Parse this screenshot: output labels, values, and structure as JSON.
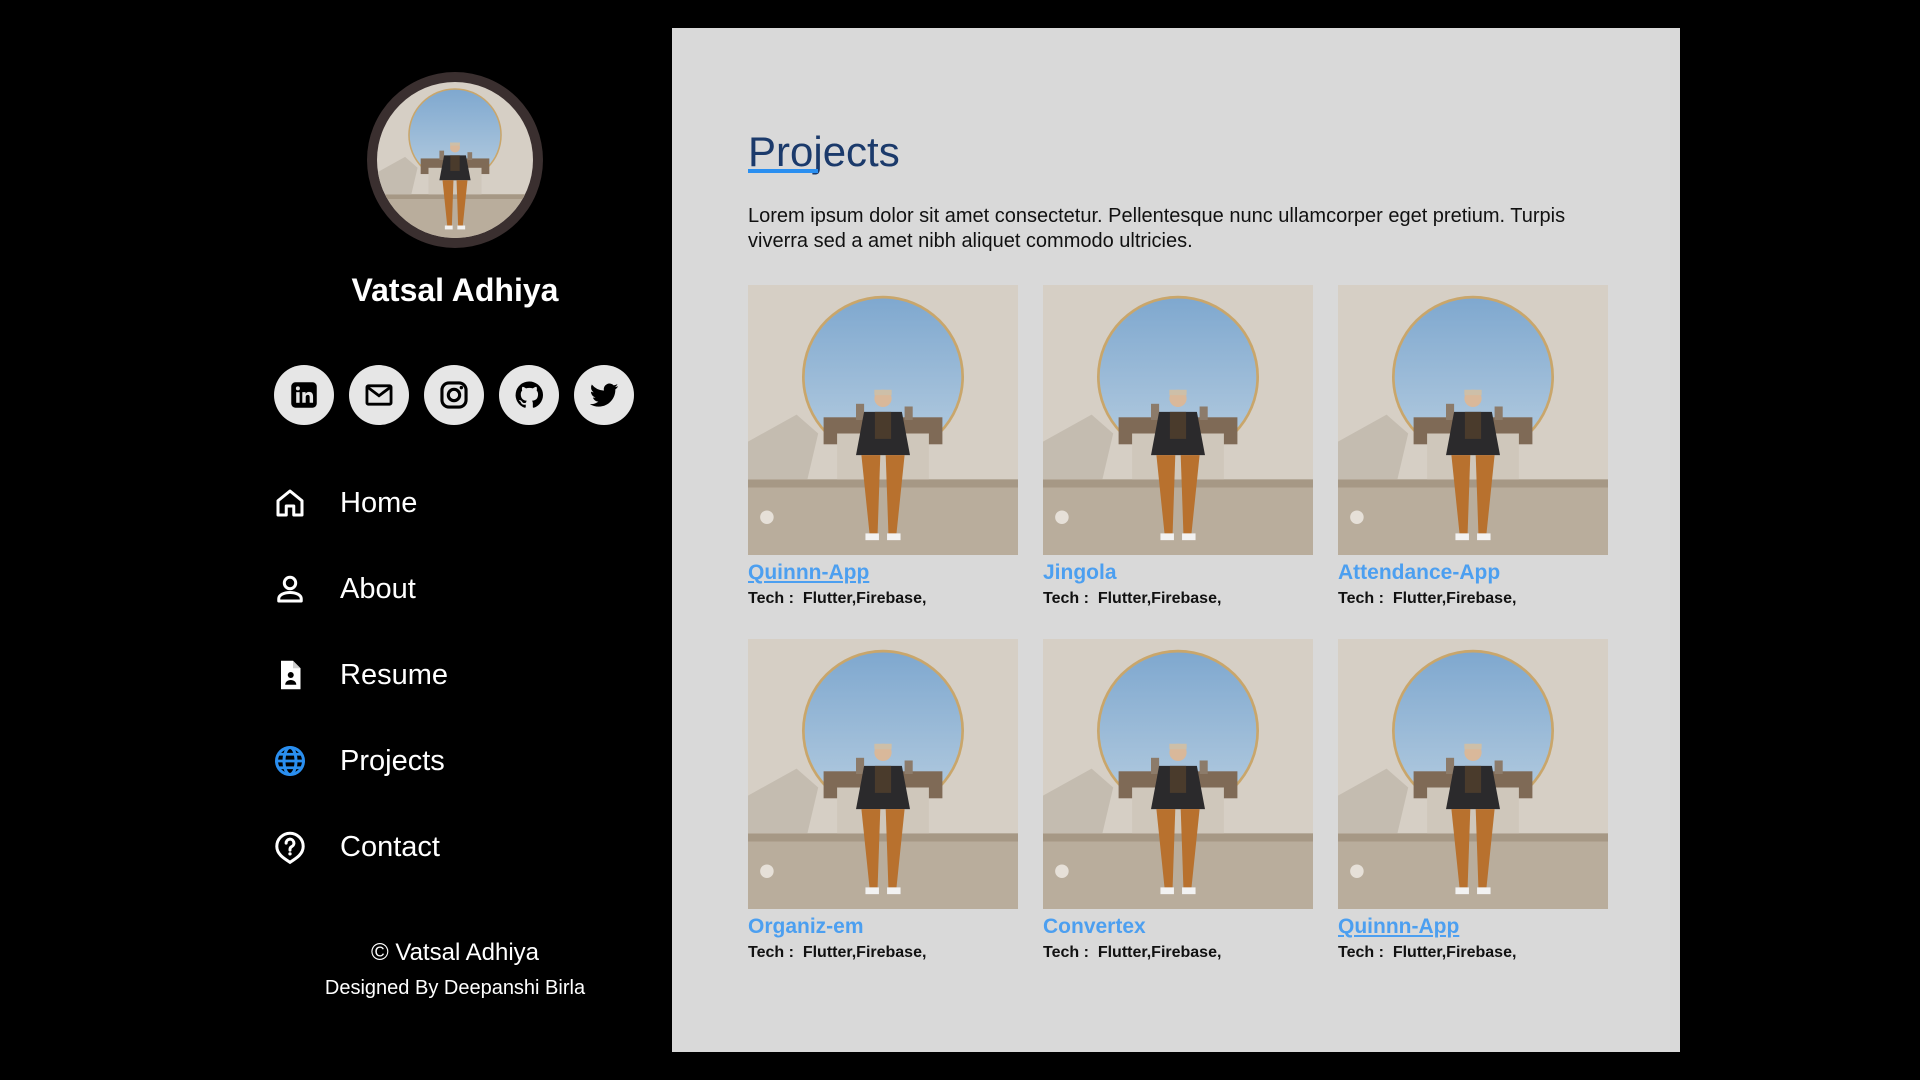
{
  "profile": {
    "name": "Vatsal Adhiya"
  },
  "socials": [
    {
      "name": "linkedin",
      "icon": "linkedin-icon"
    },
    {
      "name": "email",
      "icon": "mail-icon"
    },
    {
      "name": "instagram",
      "icon": "instagram-icon"
    },
    {
      "name": "github",
      "icon": "github-icon"
    },
    {
      "name": "twitter",
      "icon": "twitter-icon"
    }
  ],
  "nav": {
    "items": [
      {
        "label": "Home",
        "icon": "home-icon",
        "active": false
      },
      {
        "label": "About",
        "icon": "user-icon",
        "active": false
      },
      {
        "label": "Resume",
        "icon": "document-icon",
        "active": false
      },
      {
        "label": "Projects",
        "icon": "globe-icon",
        "active": true
      },
      {
        "label": "Contact",
        "icon": "help-icon",
        "active": false
      }
    ]
  },
  "footer": {
    "copyright": "© Vatsal Adhiya",
    "designer": "Designed By Deepanshi Birla"
  },
  "main": {
    "title": "Projects",
    "intro": "Lorem ipsum dolor sit amet consectetur. Pellentesque nunc ullamcorper eget pretium. Turpis viverra sed a amet nibh aliquet commodo ultricies."
  },
  "projects": [
    {
      "title": "Quinnn-App",
      "tech_label": "Tech :",
      "tech": "Flutter,Firebase,",
      "underlined": true
    },
    {
      "title": "Jingola",
      "tech_label": "Tech :",
      "tech": "Flutter,Firebase,",
      "underlined": false
    },
    {
      "title": "Attendance-App",
      "tech_label": "Tech :",
      "tech": "Flutter,Firebase,",
      "underlined": false
    },
    {
      "title": "Organiz-em",
      "tech_label": "Tech :",
      "tech": "Flutter,Firebase,",
      "underlined": false
    },
    {
      "title": "Convertex",
      "tech_label": "Tech :",
      "tech": "Flutter,Firebase,",
      "underlined": false
    },
    {
      "title": "Quinnn-App",
      "tech_label": "Tech :",
      "tech": "Flutter,Firebase,",
      "underlined": true
    }
  ],
  "colors": {
    "accent": "#2a8ff0",
    "link": "#4c9ff0",
    "title": "#1b3a6b",
    "panel": "#d9d9d9",
    "sidebar": "#000000"
  }
}
